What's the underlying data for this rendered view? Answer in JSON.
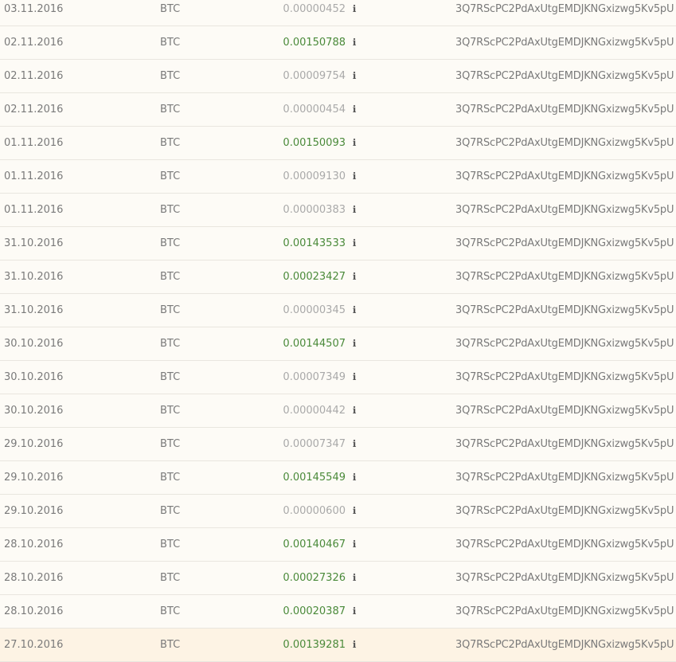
{
  "transactions": [
    {
      "date": "03.11.2016",
      "currency": "BTC",
      "amount": "0.00000452",
      "amount_status": "grey",
      "info_icon": "ℹ",
      "address": "3Q7RScPC2PdAxUtgEMDJKNGxizwg5Kv5pU"
    },
    {
      "date": "02.11.2016",
      "currency": "BTC",
      "amount": "0.00150788",
      "amount_status": "green",
      "info_icon": "ℹ",
      "address": "3Q7RScPC2PdAxUtgEMDJKNGxizwg5Kv5pU"
    },
    {
      "date": "02.11.2016",
      "currency": "BTC",
      "amount": "0.00009754",
      "amount_status": "grey",
      "info_icon": "ℹ",
      "address": "3Q7RScPC2PdAxUtgEMDJKNGxizwg5Kv5pU"
    },
    {
      "date": "02.11.2016",
      "currency": "BTC",
      "amount": "0.00000454",
      "amount_status": "grey",
      "info_icon": "ℹ",
      "address": "3Q7RScPC2PdAxUtgEMDJKNGxizwg5Kv5pU"
    },
    {
      "date": "01.11.2016",
      "currency": "BTC",
      "amount": "0.00150093",
      "amount_status": "green",
      "info_icon": "ℹ",
      "address": "3Q7RScPC2PdAxUtgEMDJKNGxizwg5Kv5pU"
    },
    {
      "date": "01.11.2016",
      "currency": "BTC",
      "amount": "0.00009130",
      "amount_status": "grey",
      "info_icon": "ℹ",
      "address": "3Q7RScPC2PdAxUtgEMDJKNGxizwg5Kv5pU"
    },
    {
      "date": "01.11.2016",
      "currency": "BTC",
      "amount": "0.00000383",
      "amount_status": "grey",
      "info_icon": "ℹ",
      "address": "3Q7RScPC2PdAxUtgEMDJKNGxizwg5Kv5pU"
    },
    {
      "date": "31.10.2016",
      "currency": "BTC",
      "amount": "0.00143533",
      "amount_status": "green",
      "info_icon": "ℹ",
      "address": "3Q7RScPC2PdAxUtgEMDJKNGxizwg5Kv5pU"
    },
    {
      "date": "31.10.2016",
      "currency": "BTC",
      "amount": "0.00023427",
      "amount_status": "green",
      "info_icon": "ℹ",
      "address": "3Q7RScPC2PdAxUtgEMDJKNGxizwg5Kv5pU"
    },
    {
      "date": "31.10.2016",
      "currency": "BTC",
      "amount": "0.00000345",
      "amount_status": "grey",
      "info_icon": "ℹ",
      "address": "3Q7RScPC2PdAxUtgEMDJKNGxizwg5Kv5pU"
    },
    {
      "date": "30.10.2016",
      "currency": "BTC",
      "amount": "0.00144507",
      "amount_status": "green",
      "info_icon": "ℹ",
      "address": "3Q7RScPC2PdAxUtgEMDJKNGxizwg5Kv5pU"
    },
    {
      "date": "30.10.2016",
      "currency": "BTC",
      "amount": "0.00007349",
      "amount_status": "grey",
      "info_icon": "ℹ",
      "address": "3Q7RScPC2PdAxUtgEMDJKNGxizwg5Kv5pU"
    },
    {
      "date": "30.10.2016",
      "currency": "BTC",
      "amount": "0.00000442",
      "amount_status": "grey",
      "info_icon": "ℹ",
      "address": "3Q7RScPC2PdAxUtgEMDJKNGxizwg5Kv5pU"
    },
    {
      "date": "29.10.2016",
      "currency": "BTC",
      "amount": "0.00007347",
      "amount_status": "grey",
      "info_icon": "ℹ",
      "address": "3Q7RScPC2PdAxUtgEMDJKNGxizwg5Kv5pU"
    },
    {
      "date": "29.10.2016",
      "currency": "BTC",
      "amount": "0.00145549",
      "amount_status": "green",
      "info_icon": "ℹ",
      "address": "3Q7RScPC2PdAxUtgEMDJKNGxizwg5Kv5pU"
    },
    {
      "date": "29.10.2016",
      "currency": "BTC",
      "amount": "0.00000600",
      "amount_status": "grey",
      "info_icon": "ℹ",
      "address": "3Q7RScPC2PdAxUtgEMDJKNGxizwg5Kv5pU"
    },
    {
      "date": "28.10.2016",
      "currency": "BTC",
      "amount": "0.00140467",
      "amount_status": "green",
      "info_icon": "ℹ",
      "address": "3Q7RScPC2PdAxUtgEMDJKNGxizwg5Kv5pU"
    },
    {
      "date": "28.10.2016",
      "currency": "BTC",
      "amount": "0.00027326",
      "amount_status": "green",
      "info_icon": "ℹ",
      "address": "3Q7RScPC2PdAxUtgEMDJKNGxizwg5Kv5pU"
    },
    {
      "date": "28.10.2016",
      "currency": "BTC",
      "amount": "0.00020387",
      "amount_status": "green",
      "info_icon": "ℹ",
      "address": "3Q7RScPC2PdAxUtgEMDJKNGxizwg5Kv5pU"
    },
    {
      "date": "27.10.2016",
      "currency": "BTC",
      "amount": "0.00139281",
      "amount_status": "green",
      "info_icon": "ℹ",
      "address": "3Q7RScPC2PdAxUtgEMDJKNGxizwg5Kv5pU",
      "highlighted": true
    }
  ],
  "colors": {
    "confirmed_amount": "#4a8a3a",
    "pending_amount": "#a9a9a9",
    "row_background": "#fdfbf6",
    "highlight_row_background": "#fdf3e4"
  }
}
